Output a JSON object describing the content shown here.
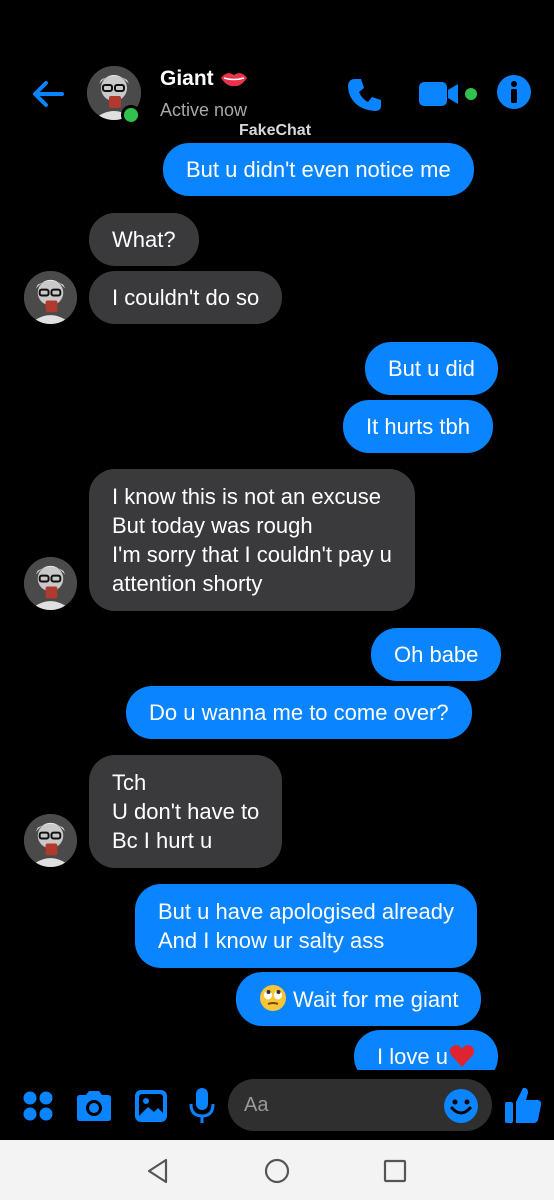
{
  "header": {
    "name": "Giant",
    "status": "Active now",
    "watermark": "FakeChat",
    "icons": [
      "back-arrow-icon",
      "phone-icon",
      "video-camera-icon",
      "info-icon",
      "lips-icon"
    ],
    "accent_color": "#0a84ff",
    "online_color": "#31c24d"
  },
  "messages": [
    {
      "from": "me",
      "lines": [
        "But u didn't even notice me"
      ]
    },
    {
      "from": "them",
      "lines": [
        "What?"
      ]
    },
    {
      "from": "them",
      "lines": [
        "I couldn't do so"
      ]
    },
    {
      "from": "me",
      "lines": [
        "But u did"
      ]
    },
    {
      "from": "me",
      "lines": [
        "It hurts tbh"
      ]
    },
    {
      "from": "them",
      "lines": [
        "I know this is not an excuse",
        "But today was rough",
        "I'm sorry that I couldn't pay u",
        "attention shorty"
      ]
    },
    {
      "from": "me",
      "lines": [
        "Oh babe"
      ]
    },
    {
      "from": "me",
      "lines": [
        "Do u wanna me to come over?"
      ]
    },
    {
      "from": "them",
      "lines": [
        "Tch",
        "U don't have to",
        "Bc I hurt u"
      ]
    },
    {
      "from": "me",
      "lines": [
        "But u have apologised already",
        "And I know ur salty ass"
      ]
    },
    {
      "from": "me",
      "lines": [
        "Wait for me giant"
      ],
      "emoji": "eye-roll-emoji"
    },
    {
      "from": "me",
      "lines": [
        "I love u"
      ],
      "emoji_after": "red-heart-emoji"
    }
  ],
  "composer": {
    "placeholder": "Aa",
    "icons": [
      "apps-icon",
      "camera-icon",
      "gallery-icon",
      "microphone-icon",
      "emoji-icon",
      "thumbs-up-icon"
    ]
  },
  "navbar": {
    "icons": [
      "nav-back-icon",
      "nav-home-icon",
      "nav-recents-icon"
    ]
  }
}
